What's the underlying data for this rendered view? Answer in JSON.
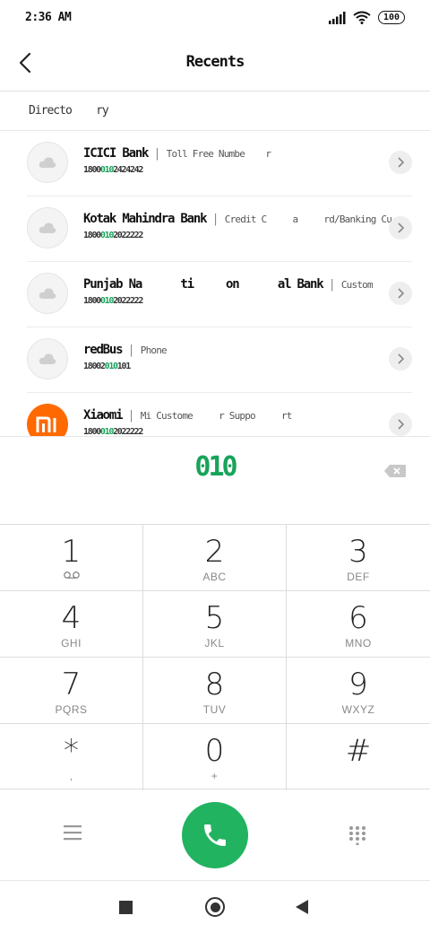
{
  "status_bar": {
    "time": "2:36 AM",
    "battery": "100",
    "icons": [
      "signal-icon",
      "wifi-icon",
      "battery-icon"
    ]
  },
  "header": {
    "title": "Recents",
    "back_icon": "chevron-left-icon"
  },
  "directory": {
    "label": "Directo    ry"
  },
  "contacts": [
    {
      "name": "ICICI Bank",
      "label": "Toll Free Numbe    r",
      "number_pre": "1800",
      "number_hl": "010",
      "number_post": "2424242",
      "avatar": "cloud-icon"
    },
    {
      "name": "Kotak Mahindra Bank",
      "label": "Credit C     a     rd/Banking Cu",
      "number_pre": "1800",
      "number_hl": "010",
      "number_post": "2022222",
      "avatar": "cloud-icon"
    },
    {
      "name": "Punjab Na      ti     on      al Bank",
      "label": "Custom",
      "number_pre": "1800",
      "number_hl": "010",
      "number_post": "2022222",
      "avatar": "cloud-icon"
    },
    {
      "name": "redBus",
      "label": "Phone",
      "number_pre": "18002",
      "number_hl": "010",
      "number_post": "101",
      "avatar": "cloud-icon"
    },
    {
      "name": "Xiaomi",
      "label": "Mi Custome     r Suppo     rt",
      "number_pre": "1800",
      "number_hl": "010",
      "number_post": "2022222",
      "avatar": "mi-logo-icon"
    }
  ],
  "dialer": {
    "dialed_number": "010",
    "backspace_icon": "backspace-icon"
  },
  "keypad": [
    {
      "digit": "1",
      "letters": "",
      "sub_icon": "voicemail-icon"
    },
    {
      "digit": "2",
      "letters": "ABC"
    },
    {
      "digit": "3",
      "letters": "DEF"
    },
    {
      "digit": "4",
      "letters": "GHI"
    },
    {
      "digit": "5",
      "letters": "JKL"
    },
    {
      "digit": "6",
      "letters": "MNO"
    },
    {
      "digit": "7",
      "letters": "PQRS"
    },
    {
      "digit": "8",
      "letters": "TUV"
    },
    {
      "digit": "9",
      "letters": "WXYZ"
    },
    {
      "digit": "*",
      "letters": ","
    },
    {
      "digit": "0",
      "letters": "+"
    },
    {
      "digit": "#",
      "letters": ""
    }
  ],
  "actions": {
    "menu_icon": "menu-icon",
    "call_icon": "phone-icon",
    "keypad_icon": "dialpad-icon"
  },
  "colors": {
    "accent": "#19a35a",
    "call_button": "#22b361",
    "brand_mi": "#ff6900"
  }
}
